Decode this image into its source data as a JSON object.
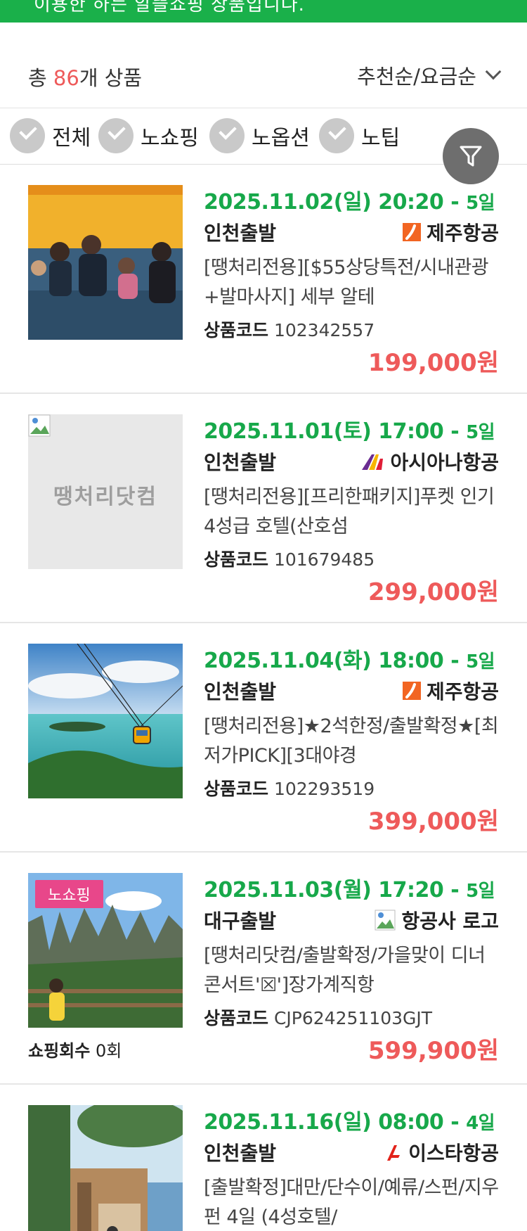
{
  "banner": {
    "text": "이용한 하는 알뜰쇼핑 상품입니다."
  },
  "summary": {
    "count_prefix": "총 ",
    "count_value": "86",
    "count_suffix": "개 상품",
    "sort_label": "추천순/요금순"
  },
  "filters": [
    {
      "label": "전체"
    },
    {
      "label": "노쇼핑"
    },
    {
      "label": "노옵션"
    },
    {
      "label": "노팁"
    }
  ],
  "products": [
    {
      "date": "2025.11.02(일) 20:20 - ",
      "days": "5일",
      "departure": "인천출발",
      "airline": "제주항공",
      "title": "[땡처리전용][$55상당특전/시내관광+발마사지] 세부 알테",
      "code_label": "상품코드",
      "code": "102342557",
      "price": "199,000원"
    },
    {
      "date": "2025.11.01(토) 17:00 - ",
      "days": "5일",
      "departure": "인천출발",
      "airline": "아시아나항공",
      "title": "[땡처리전용][프리한패키지]푸켓 인기 4성급 호텔(산호섬",
      "code_label": "상품코드",
      "code": "101679485",
      "price": "299,000원",
      "placeholder_text": "땡처리닷컴"
    },
    {
      "date": "2025.11.04(화) 18:00 - ",
      "days": "5일",
      "departure": "인천출발",
      "airline": "제주항공",
      "title": "[땡처리전용]★2석한정/출발확정★[최저가PICK][3대야경",
      "code_label": "상품코드",
      "code": "102293519",
      "price": "399,000원"
    },
    {
      "date": "2025.11.03(월) 17:20 - ",
      "days": "5일",
      "departure": "대구출발",
      "airline": "항공사 로고",
      "title": "[땡처리닷컴/출발확정/가을맞이 디너콘서트'☒']장가계직항",
      "code_label": "상품코드",
      "code": "CJP624251103GJT",
      "price": "599,900원",
      "badge": "노쇼핑",
      "shopping_label": "쇼핑회수",
      "shopping_value": "0회"
    },
    {
      "date": "2025.11.16(일) 08:00 - ",
      "days": "4일",
      "departure": "인천출발",
      "airline": "이스타항공",
      "title": "[출발확정]대만/단수이/예류/스펀/지우펀 4일 (4성호텔/",
      "code_label": "상품코드",
      "code": "",
      "price": ""
    }
  ],
  "colors": {
    "brand_green": "#1ab04a",
    "price_red": "#ee5a5a",
    "badge_pink": "#e8478a"
  }
}
